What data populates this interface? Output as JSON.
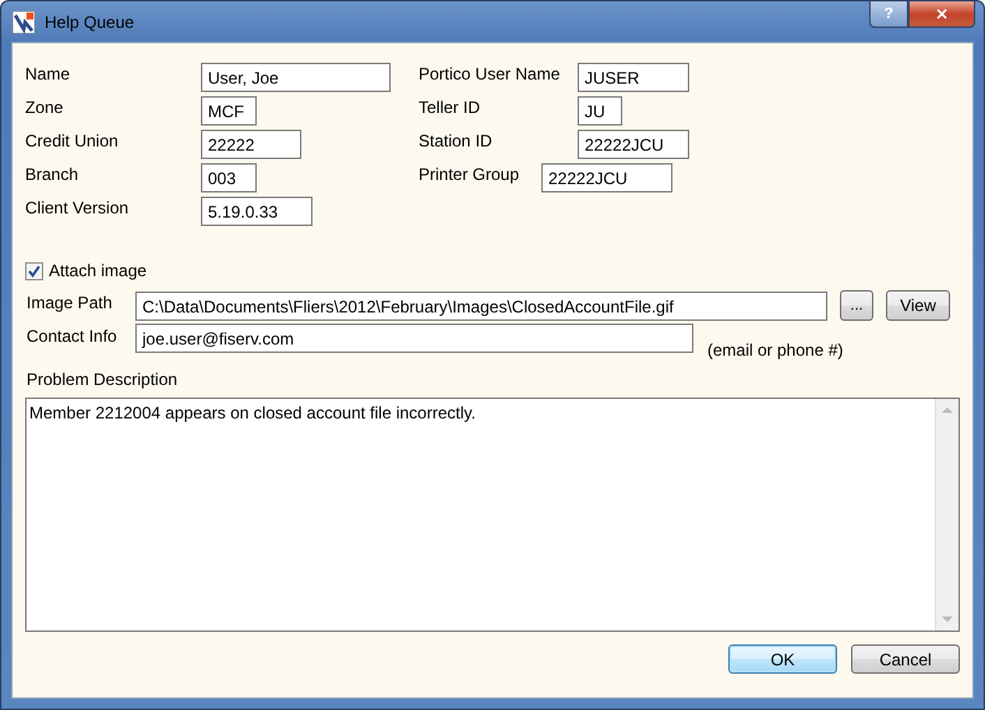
{
  "window": {
    "title": "Help Queue",
    "help_button": "?",
    "close_button": "✕"
  },
  "left_fields": [
    {
      "label": "Name",
      "value": "User, Joe"
    },
    {
      "label": "Zone",
      "value": "MCF"
    },
    {
      "label": "Credit Union",
      "value": "22222"
    },
    {
      "label": "Branch",
      "value": "003"
    },
    {
      "label": "Client Version",
      "value": "5.19.0.33"
    }
  ],
  "right_fields": [
    {
      "label": "Portico User Name",
      "value": "JUSER"
    },
    {
      "label": "Teller ID",
      "value": "JU"
    },
    {
      "label": "Station ID",
      "value": "22222JCU"
    },
    {
      "label": "Printer Group",
      "value": "22222JCU"
    }
  ],
  "attach_image": {
    "label": "Attach image",
    "checked": true
  },
  "image_path": {
    "label": "Image Path",
    "value": "C:\\Data\\Documents\\Fliers\\2012\\February\\Images\\ClosedAccountFile.gif",
    "browse_button": "...",
    "view_button": "View"
  },
  "contact_info": {
    "label": "Contact Info",
    "value": "joe.user@fiserv.com",
    "hint": "(email or phone #)"
  },
  "problem_description": {
    "label": "Problem Description",
    "value": "Member 2212004 appears on closed account file incorrectly."
  },
  "buttons": [
    {
      "label": "OK",
      "selected": true
    },
    {
      "label": "Cancel",
      "selected": false
    }
  ]
}
